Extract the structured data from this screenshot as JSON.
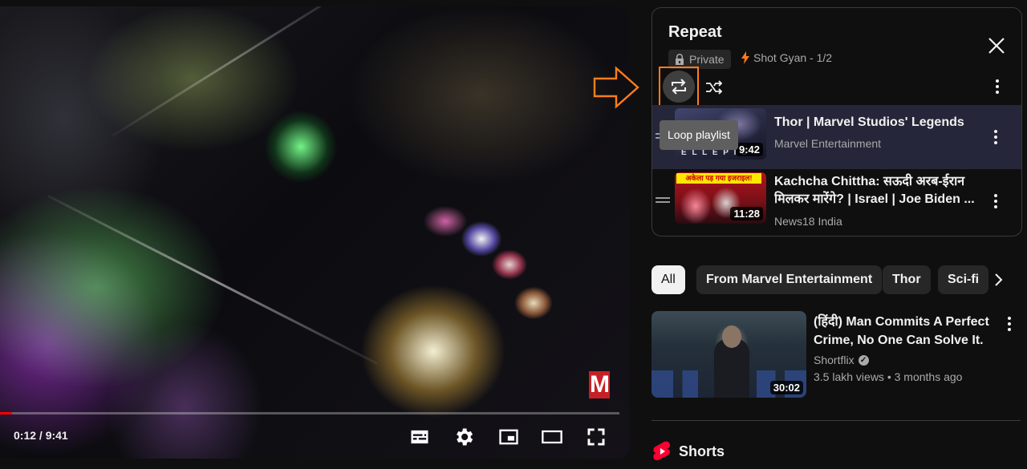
{
  "player": {
    "time": "0:12 / 9:41",
    "progress_fraction": 0.02,
    "watermark_logo": "M",
    "controls": [
      "subtitles-icon",
      "settings-icon",
      "miniplayer-icon",
      "theater-mode-icon",
      "fullscreen-icon"
    ]
  },
  "playlist": {
    "title": "Repeat",
    "privacy": "Private",
    "owner_position": "Shot Gyan - 1/2",
    "tooltip": "Loop playlist",
    "items": [
      {
        "title": "Thor | Marvel Studios' Legends",
        "channel": "Marvel Entertainment",
        "duration": "9:42",
        "thumb_text": "E L L    E P I S"
      },
      {
        "title": "Kachcha Chittha: सऊदी अरब-ईरान मिलकर मारेंगे? | Israel | Joe Biden ...",
        "channel": "News18 India",
        "duration": "11:28",
        "thumb_text": "अकेला पड़ गया इजराइल!"
      }
    ]
  },
  "chips": [
    "All",
    "From Marvel Entertainment",
    "Thor",
    "Sci-fi"
  ],
  "recommendation": {
    "title": "(हिंदी) Man Commits A Perfect Crime, No One Can Solve It.",
    "channel": "Shortflix",
    "views": "3.5 lakh views",
    "age": "3 months ago",
    "duration": "30:02"
  },
  "shorts": {
    "label": "Shorts"
  },
  "colors": {
    "background": "#0f0f0f",
    "highlight_annotation": "#ff7d1a",
    "active_item": "#26263a",
    "progress": "#ff0000",
    "shorts_red": "#ff0033"
  }
}
